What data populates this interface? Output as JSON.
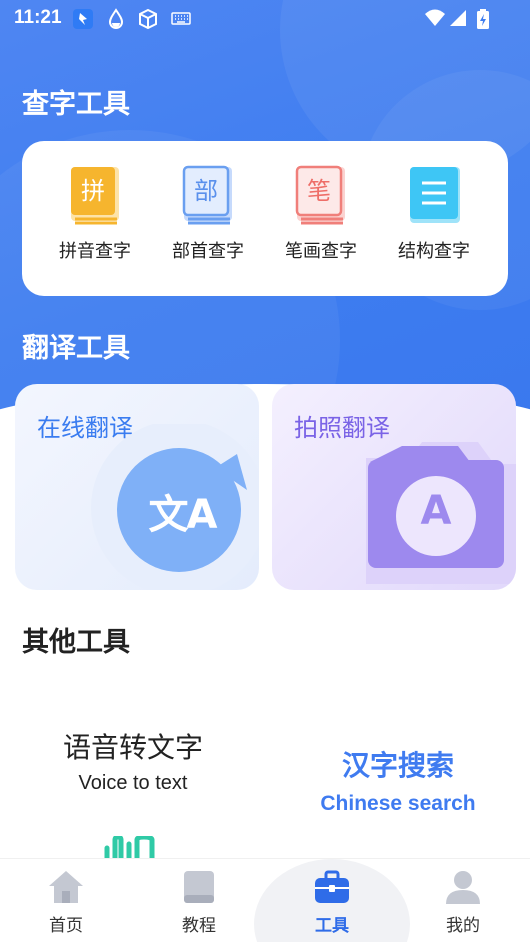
{
  "status_bar": {
    "time": "11:21"
  },
  "colors": {
    "brand_blue": "#3e7df0",
    "active_tab": "#2f6ce8",
    "pinyin_orange": "#f6b52e",
    "radical_blue": "#6a9ff0",
    "stroke_red": "#f07f7a",
    "structure_cyan": "#3ec6f5",
    "photo_purple": "#7a63e6"
  },
  "lookup": {
    "title": "查字工具",
    "items": [
      {
        "label": "拼音查字",
        "glyph": "拼",
        "icon": "pinyin-book-icon"
      },
      {
        "label": "部首查字",
        "glyph": "部",
        "icon": "radical-book-icon"
      },
      {
        "label": "笔画查字",
        "glyph": "笔",
        "icon": "stroke-book-icon"
      },
      {
        "label": "结构查字",
        "glyph": "",
        "icon": "structure-book-icon"
      }
    ]
  },
  "translate": {
    "title": "翻译工具",
    "online": {
      "label": "在线翻译",
      "icon_text": "文A"
    },
    "photo": {
      "label": "拍照翻译",
      "icon_text": "A"
    }
  },
  "other": {
    "title": "其他工具",
    "voice": {
      "title": "语音转文字",
      "subtitle": "Voice to text"
    },
    "search": {
      "title": "汉字搜索",
      "subtitle": "Chinese search"
    }
  },
  "tabs": [
    {
      "label": "首页",
      "icon": "home-icon"
    },
    {
      "label": "教程",
      "icon": "book-icon"
    },
    {
      "label": "工具",
      "icon": "toolbox-icon",
      "active": true
    },
    {
      "label": "我的",
      "icon": "person-icon"
    }
  ]
}
